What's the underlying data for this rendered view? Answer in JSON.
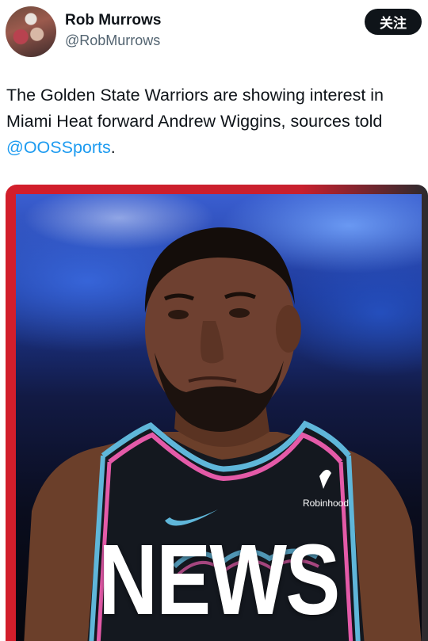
{
  "author": {
    "name": "Rob Murrows",
    "handle": "@RobMurrows",
    "follow_label": "关注"
  },
  "tweet": {
    "text_before": "The Golden State Warriors are showing interest in Miami Heat forward Andrew Wiggins, sources told ",
    "mention": "@OOSSports",
    "text_after": "."
  },
  "media": {
    "jersey_sponsor": "Robinhood",
    "overlay_text": "NEWS"
  }
}
